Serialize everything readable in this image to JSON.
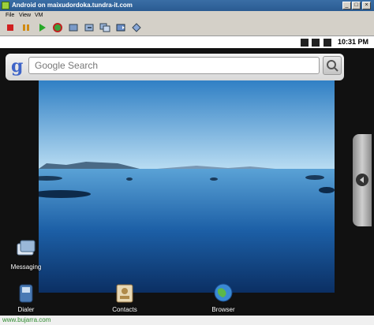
{
  "window": {
    "title": "Android on maixudordoka.tundra-it.com",
    "minimize": "_",
    "maximize": "□",
    "close": "×"
  },
  "menu": [
    "File",
    "View",
    "VM"
  ],
  "toolbar": {
    "buttons": [
      "stop-icon",
      "pause-icon",
      "play-icon",
      "reset-icon",
      "snapshot-icon",
      "revert-icon",
      "manage-snapshots-icon",
      "fullscreen-icon",
      "unity-icon"
    ]
  },
  "statusbar": {
    "time": "10:31 PM",
    "icons": [
      "usb-icon",
      "signal-icon",
      "battery-icon"
    ]
  },
  "search": {
    "logo": "g",
    "placeholder": "Google Search"
  },
  "apps": {
    "messaging": "Messaging",
    "dialer": "Dialer",
    "contacts": "Contacts",
    "browser": "Browser"
  },
  "watermark": "www.bujarra.com",
  "colors": {
    "titlebar": "#2a5b92",
    "google_blue": "#3e64c8",
    "watermark": "#2e8b2e"
  }
}
